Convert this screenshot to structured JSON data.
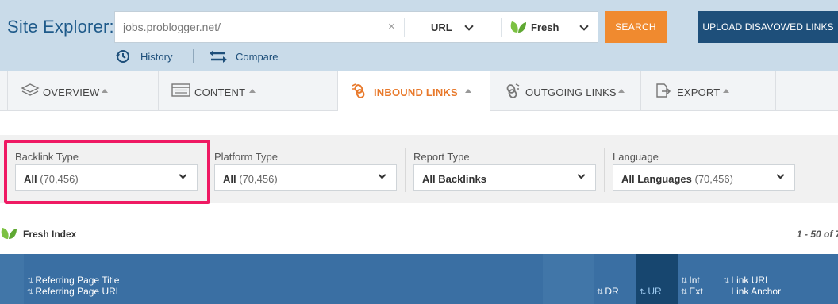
{
  "header": {
    "title": "Site Explorer:",
    "search": {
      "value": "jobs.problogger.net/",
      "clear_icon": "×"
    },
    "mode": {
      "selected": "URL"
    },
    "index": {
      "selected": "Fresh"
    },
    "search_button": "SEARCH",
    "upload_button": "UPLOAD DISAVOWED LINKS",
    "history": "History",
    "compare": "Compare"
  },
  "tabs": [
    {
      "label": "OVERVIEW",
      "icon": "layers-icon",
      "active": false
    },
    {
      "label": "CONTENT",
      "icon": "list-window-icon",
      "active": false
    },
    {
      "label": "INBOUND LINKS",
      "icon": "inbound-link-icon",
      "active": true
    },
    {
      "label": "OUTGOING LINKS",
      "icon": "outgoing-link-icon",
      "active": false
    },
    {
      "label": "EXPORT",
      "icon": "export-icon",
      "active": false
    }
  ],
  "filters": [
    {
      "label": "Backlink Type",
      "value": "All",
      "count": "(70,456)"
    },
    {
      "label": "Platform Type",
      "value": "All",
      "count": "(70,456)"
    },
    {
      "label": "Report Type",
      "value": "All Backlinks",
      "count": ""
    },
    {
      "label": "Language",
      "value": "All Languages",
      "count": "(70,456)"
    }
  ],
  "fresh_index_label": "Fresh Index",
  "pagination": "1 - 50 of 7",
  "table_header": {
    "referring_title": "Referring Page Title",
    "referring_url": "Referring Page URL",
    "dr": "DR",
    "ur": "UR",
    "int": "Int",
    "ext": "Ext",
    "link_url": "Link URL",
    "link_anchor": "Link Anchor"
  },
  "colors": {
    "brand_blue": "#1e4f7a",
    "accent_orange": "#f08a2f",
    "highlight_pink": "#ef1a63",
    "fresh_green": "#6fb33f"
  }
}
